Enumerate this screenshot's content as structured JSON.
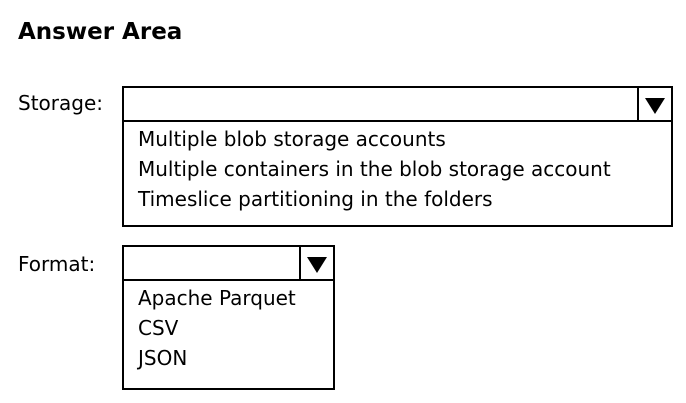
{
  "title": "Answer Area",
  "storage": {
    "label": "Storage:",
    "selected": "",
    "options": [
      "Multiple blob storage accounts",
      "Multiple containers in the blob storage account",
      "Timeslice partitioning in the folders"
    ]
  },
  "format": {
    "label": "Format:",
    "selected": "",
    "options": [
      "Apache Parquet",
      "CSV",
      "JSON"
    ]
  },
  "icons": {
    "dropdown_arrow": "triangle-down-icon"
  }
}
